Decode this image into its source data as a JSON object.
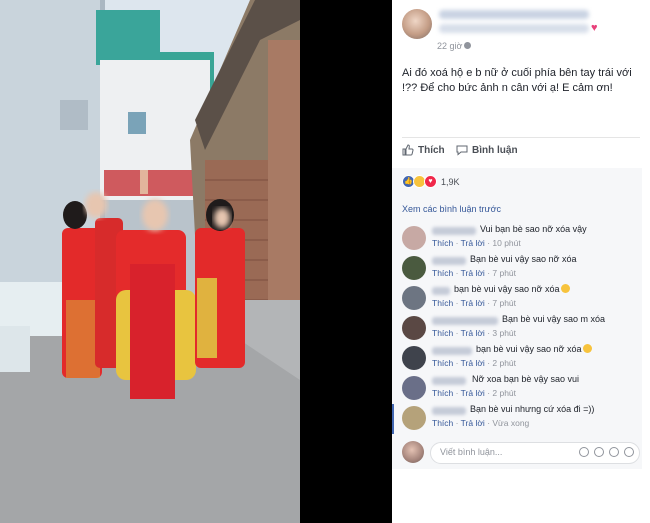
{
  "post": {
    "time": "22 giờ",
    "caption": "Ai đó xoá hộ e b nữ ở cuối phía bên tay trái với !?? Để cho bức ảnh n cân với ạ! E cảm ơn!",
    "like_label": "Thích",
    "comment_label": "Bình luận",
    "reaction_count": "1,9K",
    "view_more": "Xem các bình luận trước"
  },
  "comments": [
    {
      "text": "Vui bạn bè sao nỡ xóa vậy",
      "reply": "Trả lời",
      "like": "Thích",
      "time": "10 phút",
      "avatar": "#c7a9a4"
    },
    {
      "text": "Bạn bè vui vậy sao nỡ xóa",
      "reply": "Trả lời",
      "like": "Thích",
      "time": "7 phút",
      "avatar": "#4a5a3f"
    },
    {
      "text": "bạn bè vui vậy sao nỡ xóa",
      "reply": "Trả lời",
      "like": "Thích",
      "time": "7 phút",
      "avatar": "#6d7582"
    },
    {
      "text": "Bạn bè vui vậy sao m xóa",
      "reply": "Trả lời",
      "like": "Thích",
      "time": "3 phút",
      "avatar": "#5a4844"
    },
    {
      "text": "bạn bè vui vậy sao nỡ xóa",
      "reply": "Trả lời",
      "like": "Thích",
      "time": "2 phút",
      "avatar": "#3f434c"
    },
    {
      "text": "Nỡ xoa bạn bè vậy sao vui",
      "reply": "Trả lời",
      "like": "Thích",
      "time": "2 phút",
      "avatar": "#6a6f88"
    },
    {
      "text": "Bạn bè vui nhưng cứ xóa đi =))",
      "reply": "Trả lời",
      "like": "Thích",
      "time": "Vừa xong",
      "avatar": "#b5a27a"
    }
  ],
  "composer": {
    "placeholder": "Viết bình luận..."
  },
  "icons": [
    "globe-icon",
    "like-icon",
    "comment-icon",
    "camera-icon",
    "gif-icon",
    "sticker-icon",
    "emoji-icon"
  ],
  "colors": {
    "link": "#365899",
    "like_reaction": "#4267b2",
    "love_reaction": "#f0284a",
    "haha_reaction": "#f7c33d",
    "heart": "#e8417a"
  }
}
